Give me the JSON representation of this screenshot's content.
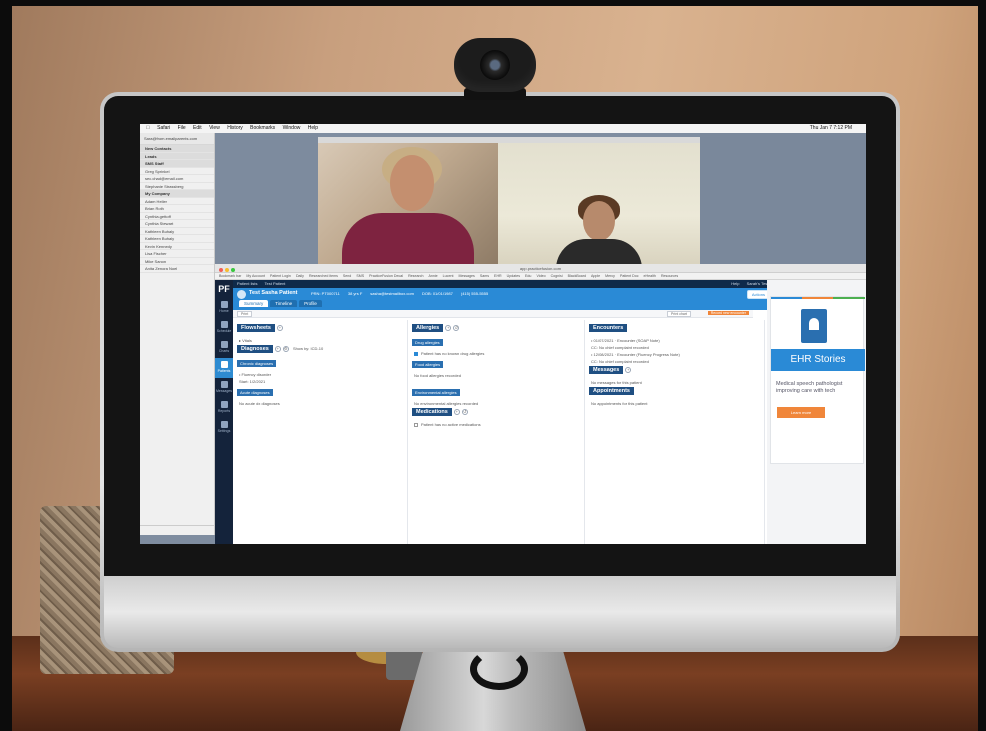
{
  "menubar": {
    "items": [
      "Safari",
      "File",
      "Edit",
      "View",
      "History",
      "Bookmarks",
      "Window",
      "Help"
    ],
    "clock": "Thu Jan 7  7:12 PM"
  },
  "contacts": {
    "user": "Sara@from.emailparents.com",
    "rows": [
      {
        "label": "New Contacts",
        "group": true
      },
      {
        "label": "Leads",
        "group": true
      },
      {
        "label": "SMS Staff",
        "group": true
      },
      {
        "label": "Greg Sprinkel",
        "group": false
      },
      {
        "label": "sec.chad@email.com",
        "group": false
      },
      {
        "label": "Stephanie Strassberg",
        "group": false
      },
      {
        "label": "My Company",
        "group": true
      },
      {
        "label": "Adam Heller",
        "group": false
      },
      {
        "label": "Brian Roth",
        "group": false
      },
      {
        "label": "Cynthia.gettoff",
        "group": false
      },
      {
        "label": "Cynthia Stewart",
        "group": false
      },
      {
        "label": "Kathleen Buhaly",
        "group": false
      },
      {
        "label": "Kathleen Buhaly",
        "group": false
      },
      {
        "label": "Kevin Kennedy",
        "group": false
      },
      {
        "label": "Lisa Fischer",
        "group": false
      },
      {
        "label": "Mike Sanon",
        "group": false
      },
      {
        "label": "Anita Zenora Noel",
        "group": false
      }
    ]
  },
  "browser": {
    "url": "app.practicefusion.com",
    "bookmarks": [
      "Bookmark bar",
      "My Account",
      "Patient Login",
      "Daily",
      "Researched items",
      "Send",
      "SMS",
      "PracticeFusion Decal",
      "Research",
      "Annie",
      "Lucent",
      "Messages",
      "Sams",
      "EHR",
      "Updates",
      "Edu",
      "Video",
      "Cognisi",
      "BlackBoard",
      "Apple",
      "Mercy",
      "Patient Doc",
      "eHealth",
      "Resources"
    ]
  },
  "app": {
    "logo": "PF",
    "nav": [
      {
        "label": "Home",
        "active": false
      },
      {
        "label": "Schedule",
        "active": false
      },
      {
        "label": "Charts",
        "active": false
      },
      {
        "label": "Patients",
        "active": true
      },
      {
        "label": "Messages",
        "active": false
      },
      {
        "label": "Reports",
        "active": false
      },
      {
        "label": "Settings",
        "active": false
      }
    ],
    "topbar": {
      "left": [
        "Patient lists",
        "Test Patient"
      ],
      "right": [
        "Help",
        "Sarah's Test EHR",
        "Test Facility",
        "Settings",
        "Log out"
      ]
    },
    "patient": {
      "name": "Test Sasha Patient",
      "meta": [
        "PRN: PT000711",
        "38 yrs F",
        "sasha@testmailbox.com",
        "DOB: 01/01/1987",
        "(415) 555-5555"
      ],
      "tabs": [
        {
          "label": "Summary",
          "active": true
        },
        {
          "label": "Timeline",
          "active": false
        },
        {
          "label": "Profile",
          "active": false
        }
      ],
      "actions_label": "Actions"
    },
    "subbar": {
      "view_label": "Print",
      "print_label": "Print chart",
      "record_label": "Record new encounter"
    },
    "col1": {
      "flowsheets": "Flowsheets",
      "vitals": "Vitals",
      "diagnoses": "Diagnoses",
      "diagnoses_filter": "Show by: ICD-10",
      "chronic_header": "Chronic diagnoses",
      "chronic_item": "Fluency disorder",
      "chronic_item_date": "Start: 1/2/2021",
      "acute_header": "Acute diagnoses",
      "acute_empty": "No acute dx diagnoses"
    },
    "col2": {
      "allergies": "Allergies",
      "drug_header": "Drug allergies",
      "drug_item": "Patient has no known drug allergies",
      "food_header": "Food allergies",
      "food_empty": "No food allergies recorded",
      "env_header": "Environmental allergies",
      "env_empty": "No environmental allergies recorded",
      "medications": "Medications",
      "med_item": "Patient has no active medications"
    },
    "col3": {
      "encounters": "Encounters",
      "enc1": "01/07/2021 · Encounter (SOAP Note)",
      "enc1_sub": "CC: No chief complaint recorded",
      "enc2": "12/08/2021 · Encounter (Fluency Progress Note)",
      "enc2_sub": "CC: No chief complaint recorded",
      "messages": "Messages",
      "messages_empty": "No messages for this patient",
      "appointments": "Appointments",
      "appointments_empty": "No appointments for this patient"
    },
    "ad": {
      "title": "EHR Stories",
      "desc": "Medical speech pathologist improving care with tech",
      "cta": "Learn more"
    }
  }
}
